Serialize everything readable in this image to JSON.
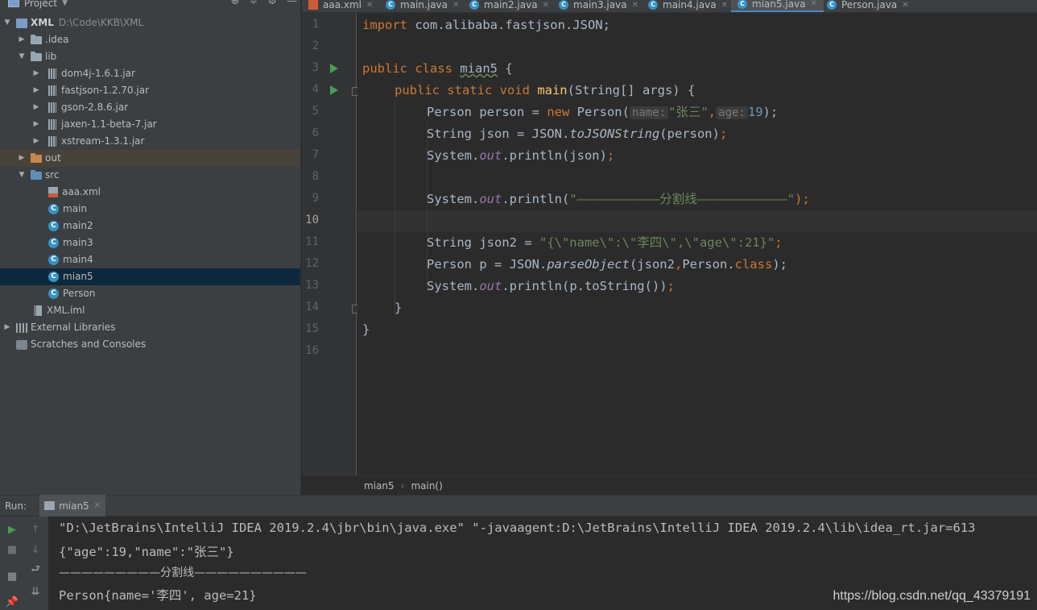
{
  "sidebar": {
    "title": "Project",
    "tree": [
      {
        "label": "XML",
        "path": "D:\\Code\\KKB\\XML"
      },
      {
        "label": ".idea"
      },
      {
        "label": "lib"
      },
      {
        "label": "dom4j-1.6.1.jar"
      },
      {
        "label": "fastjson-1.2.70.jar"
      },
      {
        "label": "gson-2.8.6.jar"
      },
      {
        "label": "jaxen-1.1-beta-7.jar"
      },
      {
        "label": "xstream-1.3.1.jar"
      },
      {
        "label": "out"
      },
      {
        "label": "src"
      },
      {
        "label": "aaa.xml"
      },
      {
        "label": "main"
      },
      {
        "label": "main2"
      },
      {
        "label": "main3"
      },
      {
        "label": "main4"
      },
      {
        "label": "mian5"
      },
      {
        "label": "Person"
      },
      {
        "label": "XML.iml"
      },
      {
        "label": "External Libraries"
      },
      {
        "label": "Scratches and Consoles"
      }
    ]
  },
  "tabs": [
    "aaa.xml",
    "main.java",
    "main2.java",
    "main3.java",
    "main4.java",
    "mian5.java",
    "Person.java"
  ],
  "active_tab": "mian5.java",
  "editor": {
    "line_numbers": [
      "1",
      "2",
      "3",
      "4",
      "5",
      "6",
      "7",
      "8",
      "9",
      "10",
      "11",
      "12",
      "13",
      "14",
      "15",
      "16"
    ],
    "l1": {
      "import": "import",
      "pkg": " com.alibaba.fastjson.JSON;"
    },
    "l3": {
      "public": "public",
      "class": " class ",
      "name": "mian5",
      "rest": " {"
    },
    "l4": {
      "mods": "public static void ",
      "name": "main",
      "rest": "(String[] args) {"
    },
    "l5": {
      "a": "Person person = ",
      "new": "new",
      "b": " Person(",
      "hint1": "name:",
      "s1": "\"张三\"",
      "comma": ",",
      "hint2": "age:",
      "n": "19",
      "end": ");"
    },
    "l6": {
      "a": "String json = JSON.",
      "m": "toJSONString",
      "b": "(person)",
      "end": ";"
    },
    "l7": {
      "a": "System.",
      "out": "out",
      "b": ".println(json)",
      "end": ";"
    },
    "l9": {
      "a": "System.",
      "out": "out",
      "b": ".println(",
      "s": "\"———————————分割线————————————\"",
      "end": ");"
    },
    "l11": {
      "a": "String json2 = ",
      "s": "\"{\\\"name\\\":\\\"李四\\\",\\\"age\\\":21}\"",
      "end": ";"
    },
    "l12": {
      "a": "Person p = JSON.",
      "m": "parseObject",
      "b": "(json2",
      "c": ",",
      "d": "Person.",
      "cls": "class",
      "end": ");"
    },
    "l13": {
      "a": "System.",
      "out": "out",
      "b": ".println(p.toString())",
      "end": ";"
    },
    "l14": "}",
    "l15": "}"
  },
  "breadcrumbs": [
    "mian5",
    "main()"
  ],
  "run": {
    "label": "Run:",
    "tab": "mian5",
    "output": [
      "\"D:\\JetBrains\\IntelliJ IDEA 2019.2.4\\jbr\\bin\\java.exe\" \"-javaagent:D:\\JetBrains\\IntelliJ IDEA 2019.2.4\\lib\\idea_rt.jar=613",
      "{\"age\":19,\"name\":\"张三\"}",
      "—————————分割线——————————",
      "Person{name='李四', age=21}"
    ]
  },
  "watermark": "https://blog.csdn.net/qq_43379191",
  "colors": {
    "keyword": "#cc7832",
    "string": "#6a8759",
    "number": "#6897bb",
    "method": "#ffc66d",
    "static_field": "#9876aa",
    "selection": "#0d293e",
    "run_green": "#499c54"
  }
}
